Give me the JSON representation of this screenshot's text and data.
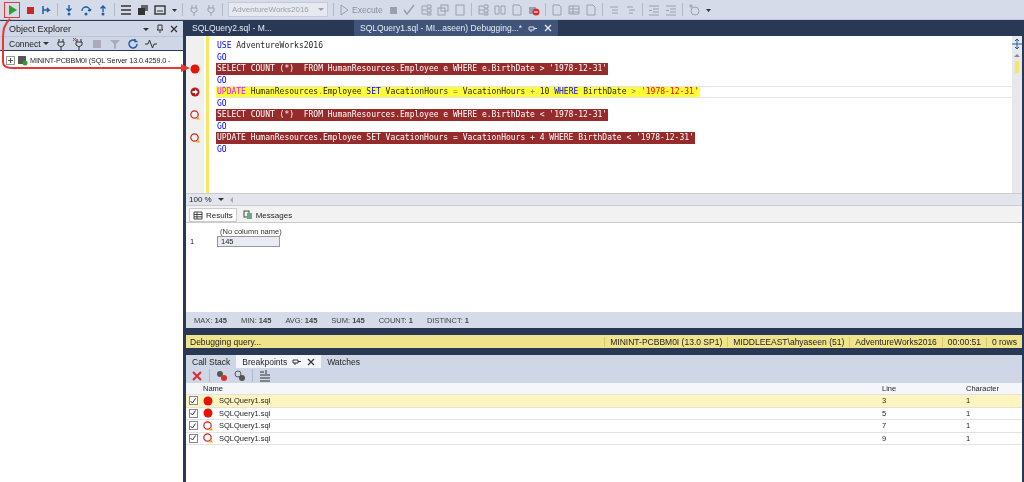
{
  "toolbar": {
    "database": "AdventureWorks2016",
    "execute": "Execute"
  },
  "object_explorer": {
    "title": "Object Explorer",
    "connect": "Connect",
    "tree": [
      {
        "label": "MININT-PCBBM0I (SQL Server 13.0.4259.0 -",
        "expanded": false
      }
    ]
  },
  "editor_tabs": [
    {
      "label": "SQLQuery2.sql - M...",
      "selected": false
    },
    {
      "label": "SQLQuery1.sql - MI...aseen) Debugging...*",
      "selected": true
    }
  ],
  "code_lines": [
    {
      "kind": "plain",
      "segments": [
        {
          "kind": "keyword",
          "t": "USE"
        },
        {
          "kind": "plain",
          "t": " AdventureWorks2016"
        }
      ]
    },
    {
      "kind": "plain",
      "segments": [
        {
          "kind": "keyword",
          "t": "GO"
        }
      ]
    },
    {
      "kind": "breakpoint",
      "segments": [
        {
          "kind": "plain",
          "t": "SELECT COUNT (*)  FROM HumanResources.Employee e WHERE e.BirthDate > '1978-12-31'"
        }
      ]
    },
    {
      "kind": "plain",
      "segments": [
        {
          "kind": "keyword",
          "t": "GO"
        }
      ]
    },
    {
      "kind": "current",
      "segments": [
        {
          "kind": "function",
          "t": "UPDATE"
        },
        {
          "kind": "plain",
          "t": " HumanResources"
        },
        {
          "kind": "operator",
          "t": "."
        },
        {
          "kind": "plain",
          "t": "Employee "
        },
        {
          "kind": "keyword",
          "t": "SET"
        },
        {
          "kind": "plain",
          "t": " VacationHours "
        },
        {
          "kind": "operator",
          "t": "="
        },
        {
          "kind": "plain",
          "t": " VacationHours "
        },
        {
          "kind": "operator",
          "t": "+"
        },
        {
          "kind": "plain",
          "t": " 10 "
        },
        {
          "kind": "keyword",
          "t": "WHERE"
        },
        {
          "kind": "plain",
          "t": " BirthDate"
        },
        {
          "kind": "operator",
          "t": " > "
        },
        {
          "kind": "string",
          "t": "'1978-12-31'"
        }
      ]
    },
    {
      "kind": "plain",
      "segments": [
        {
          "kind": "keyword",
          "t": "GO"
        }
      ]
    },
    {
      "kind": "conditional",
      "segments": [
        {
          "kind": "plain",
          "t": "SELECT COUNT (*)  FROM HumanResources.Employee e WHERE e.BirthDate < '1978-12-31'"
        }
      ]
    },
    {
      "kind": "plain",
      "segments": [
        {
          "kind": "keyword",
          "t": "GO"
        }
      ]
    },
    {
      "kind": "conditional",
      "segments": [
        {
          "kind": "plain",
          "t": "UPDATE HumanResources.Employee SET VacationHours = VacationHours + 4 WHERE BirthDate < '1978-12-31'"
        }
      ]
    },
    {
      "kind": "plain",
      "segments": [
        {
          "kind": "keyword",
          "t": "GO"
        }
      ]
    }
  ],
  "zoom": "100 %",
  "result_tabs": [
    {
      "label": "Results",
      "selected": true
    },
    {
      "label": "Messages",
      "selected": false
    }
  ],
  "results_grid": {
    "columns": [
      "(No column name)"
    ],
    "rows": [
      {
        "number": "1",
        "cells": [
          "145"
        ]
      }
    ]
  },
  "aggregates": [
    "MAX: **145**",
    "MIN: **145**",
    "AVG: **145**",
    "SUM: **145**",
    "COUNT: **1**",
    "DISTINCT: **1**"
  ],
  "status_bar": {
    "message": "Debugging query...",
    "items": [
      "MININT-PCBBM0I (13.0 SP1)",
      "MIDDLEEAST\\ahyaseen (51)",
      "AdventureWorks2016",
      "00:00:51",
      "0 rows"
    ]
  },
  "bottom_tabs": [
    {
      "label": "Call Stack",
      "selected": false
    },
    {
      "label": "Breakpoints",
      "selected": true
    },
    {
      "label": "Watches",
      "selected": false
    }
  ],
  "breakpoints": {
    "columns": [
      "Name",
      "Line",
      "Character"
    ],
    "rows": [
      {
        "checked": true,
        "kind": "breakpoint",
        "selected": true,
        "name": "SQLQuery1.sql",
        "line": "3",
        "character": "1"
      },
      {
        "checked": true,
        "kind": "breakpoint",
        "selected": false,
        "name": "SQLQuery1.sql",
        "line": "5",
        "character": "1"
      },
      {
        "checked": true,
        "kind": "conditional",
        "selected": false,
        "name": "SQLQuery1.sql",
        "line": "7",
        "character": "1"
      },
      {
        "checked": true,
        "kind": "conditional",
        "selected": false,
        "name": "SQLQuery1.sql",
        "line": "9",
        "character": "1"
      }
    ]
  }
}
